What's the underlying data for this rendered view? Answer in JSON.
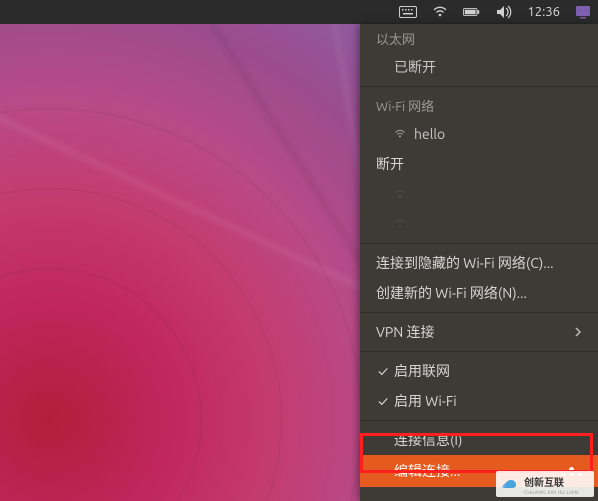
{
  "topbar": {
    "time": "12:36",
    "icons": [
      "keyboard",
      "network",
      "battery",
      "volume",
      "time",
      "shutdown"
    ]
  },
  "menu": {
    "ethernet_header": "以太网",
    "disconnected": "已断开",
    "wifi_header": "Wi-Fi 网络",
    "wifi_ssid": "hello",
    "disconnect": "断开",
    "connect_hidden": "连接到隐藏的 Wi-Fi 网络(C)...",
    "create_new": "创建新的 Wi-Fi 网络(N)...",
    "vpn": "VPN 连接",
    "enable_net": "启用联网",
    "enable_wifi": "启用 Wi-Fi",
    "conn_info": "连接信息(I)",
    "edit_conn": "编辑连接..."
  },
  "watermark": {
    "brand": "创新互联",
    "sub": "CHUANG XIN HU LIAN"
  }
}
